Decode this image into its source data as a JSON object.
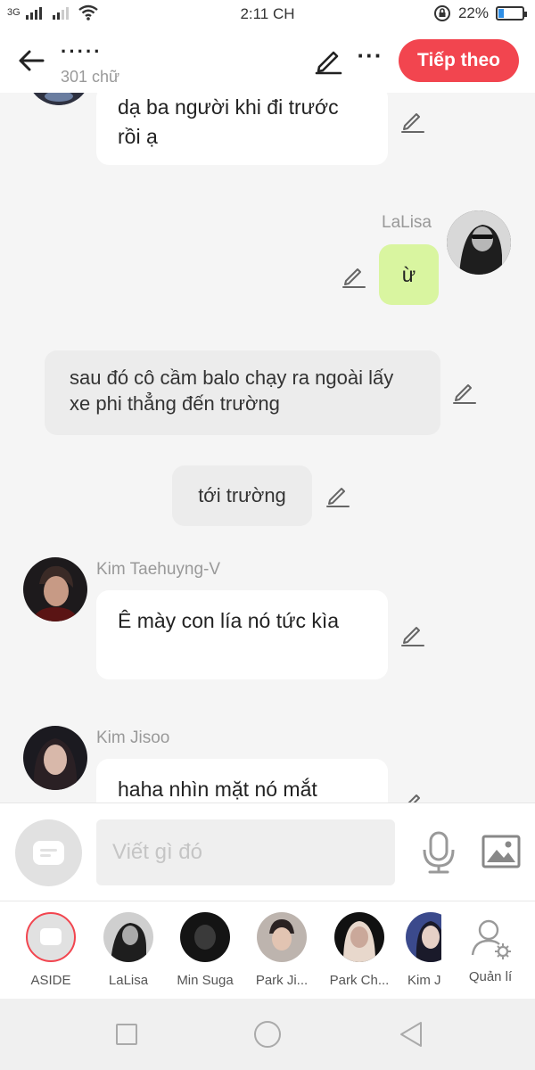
{
  "status_bar": {
    "network": "3G",
    "time": "2:11 CH",
    "battery_percent": "22%",
    "battery_level": 0.22
  },
  "header": {
    "title": "·····",
    "word_count": "301 chữ",
    "next_label": "Tiếp theo"
  },
  "messages": [
    {
      "sender": "",
      "text": "dạ ba người khi đi trước rồi ạ"
    },
    {
      "sender": "LaLisa",
      "text": "ừ"
    },
    {
      "sender": "",
      "text": "sau đó cô cầm balo chạy ra ngoài lấy xe phi thẳng đến trường"
    },
    {
      "sender": "",
      "text": "tới trường"
    },
    {
      "sender": "Kim Taehuyng-V",
      "text": "Ê mày con lía nó tức kìa"
    },
    {
      "sender": "Kim Jisoo",
      "text": "haha nhìn mặt nó mắt"
    }
  ],
  "input": {
    "placeholder": "Viết gì đó"
  },
  "characters": [
    {
      "label": "ASIDE"
    },
    {
      "label": "LaLisa"
    },
    {
      "label": "Min Suga"
    },
    {
      "label": "Park Ji..."
    },
    {
      "label": "Park Ch..."
    },
    {
      "label": "Kim J"
    },
    {
      "label": "Quản lí"
    }
  ],
  "colors": {
    "accent": "#f2454f",
    "green_bubble": "#d9f5a0",
    "gray_bubble": "#ececec",
    "background": "#f5f5f5"
  }
}
